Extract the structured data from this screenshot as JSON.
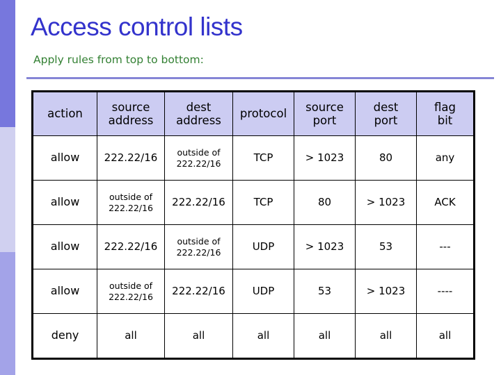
{
  "colors": {
    "title_text": "#3333cc",
    "subtitle_text": "#338033",
    "rule": "#8585d6",
    "header_fill": "#ccccf2",
    "sidebar_top": "#7777dd",
    "sidebar_mid": "#d0d0f0",
    "sidebar_bottom": "#a3a3e8",
    "border": "#000000",
    "background": "#ffffff"
  },
  "header": {
    "title": "Access control lists",
    "subtitle": "Apply rules from top to bottom:"
  },
  "table": {
    "columns": [
      "action",
      "source\naddress",
      "dest\naddress",
      "protocol",
      "source\nport",
      "dest\nport",
      "flag\nbit"
    ],
    "columns_flat": [
      {
        "line1": "action",
        "line2": ""
      },
      {
        "line1": "source",
        "line2": "address"
      },
      {
        "line1": "dest",
        "line2": "address"
      },
      {
        "line1": "protocol",
        "line2": ""
      },
      {
        "line1": "source",
        "line2": "port"
      },
      {
        "line1": "dest",
        "line2": "port"
      },
      {
        "line1": "flag",
        "line2": "bit"
      }
    ],
    "rows": [
      {
        "action": "allow",
        "source_address": "222.22/16",
        "dest_address": "outside of\n222.22/16",
        "protocol": "TCP",
        "source_port": "> 1023",
        "dest_port": "80",
        "flag_bit": "any"
      },
      {
        "action": "allow",
        "source_address": "outside of\n222.22/16",
        "dest_address": "222.22/16",
        "protocol": "TCP",
        "source_port": "80",
        "dest_port": "> 1023",
        "flag_bit": "ACK"
      },
      {
        "action": "allow",
        "source_address": "222.22/16",
        "dest_address": "outside of\n222.22/16",
        "protocol": "UDP",
        "source_port": "> 1023",
        "dest_port": "53",
        "flag_bit": "---"
      },
      {
        "action": "allow",
        "source_address": "outside of\n222.22/16",
        "dest_address": "222.22/16",
        "protocol": "UDP",
        "source_port": "53",
        "dest_port": "> 1023",
        "flag_bit": "----"
      },
      {
        "action": "deny",
        "source_address": "all",
        "dest_address": "all",
        "protocol": "all",
        "source_port": "all",
        "dest_port": "all",
        "flag_bit": "all"
      }
    ]
  }
}
